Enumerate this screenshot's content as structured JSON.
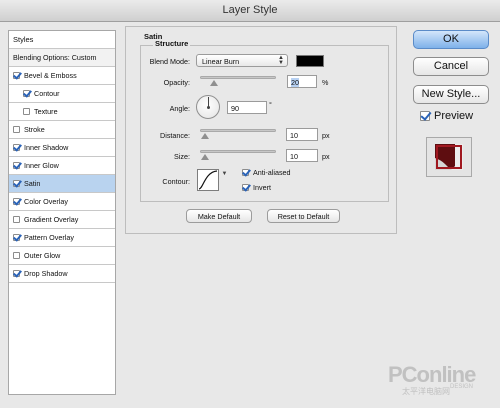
{
  "window": {
    "title": "Layer Style"
  },
  "styles_panel": {
    "header": "Styles",
    "items": [
      {
        "label": "Blending Options: Custom",
        "checkbox": false,
        "checked": false,
        "sub": false,
        "selected": false
      },
      {
        "label": "Bevel & Emboss",
        "checkbox": true,
        "checked": true,
        "sub": false,
        "selected": false
      },
      {
        "label": "Contour",
        "checkbox": true,
        "checked": true,
        "sub": true,
        "selected": false
      },
      {
        "label": "Texture",
        "checkbox": true,
        "checked": false,
        "sub": true,
        "selected": false
      },
      {
        "label": "Stroke",
        "checkbox": true,
        "checked": false,
        "sub": false,
        "selected": false
      },
      {
        "label": "Inner Shadow",
        "checkbox": true,
        "checked": true,
        "sub": false,
        "selected": false
      },
      {
        "label": "Inner Glow",
        "checkbox": true,
        "checked": true,
        "sub": false,
        "selected": false
      },
      {
        "label": "Satin",
        "checkbox": true,
        "checked": true,
        "sub": false,
        "selected": true
      },
      {
        "label": "Color Overlay",
        "checkbox": true,
        "checked": true,
        "sub": false,
        "selected": false
      },
      {
        "label": "Gradient Overlay",
        "checkbox": true,
        "checked": false,
        "sub": false,
        "selected": false
      },
      {
        "label": "Pattern Overlay",
        "checkbox": true,
        "checked": true,
        "sub": false,
        "selected": false
      },
      {
        "label": "Outer Glow",
        "checkbox": true,
        "checked": false,
        "sub": false,
        "selected": false
      },
      {
        "label": "Drop Shadow",
        "checkbox": true,
        "checked": true,
        "sub": false,
        "selected": false
      }
    ]
  },
  "satin": {
    "section_title": "Satin",
    "structure_title": "Structure",
    "blend_mode_label": "Blend Mode:",
    "blend_mode_value": "Linear Burn",
    "blend_color": "#000000",
    "opacity_label": "Opacity:",
    "opacity_value": "20",
    "opacity_unit": "%",
    "angle_label": "Angle:",
    "angle_value": "90",
    "angle_unit": "°",
    "distance_label": "Distance:",
    "distance_value": "10",
    "distance_unit": "px",
    "size_label": "Size:",
    "size_value": "10",
    "size_unit": "px",
    "contour_label": "Contour:",
    "anti_aliased_label": "Anti-aliased",
    "anti_aliased_checked": true,
    "invert_label": "Invert",
    "invert_checked": true,
    "make_default_label": "Make Default",
    "reset_default_label": "Reset to Default"
  },
  "actions": {
    "ok_label": "OK",
    "cancel_label": "Cancel",
    "new_style_label": "New Style...",
    "preview_label": "Preview",
    "preview_checked": true
  },
  "watermark": {
    "brand": "PConline",
    "cn": "太平洋电脑网",
    "site": "DESIGN"
  }
}
